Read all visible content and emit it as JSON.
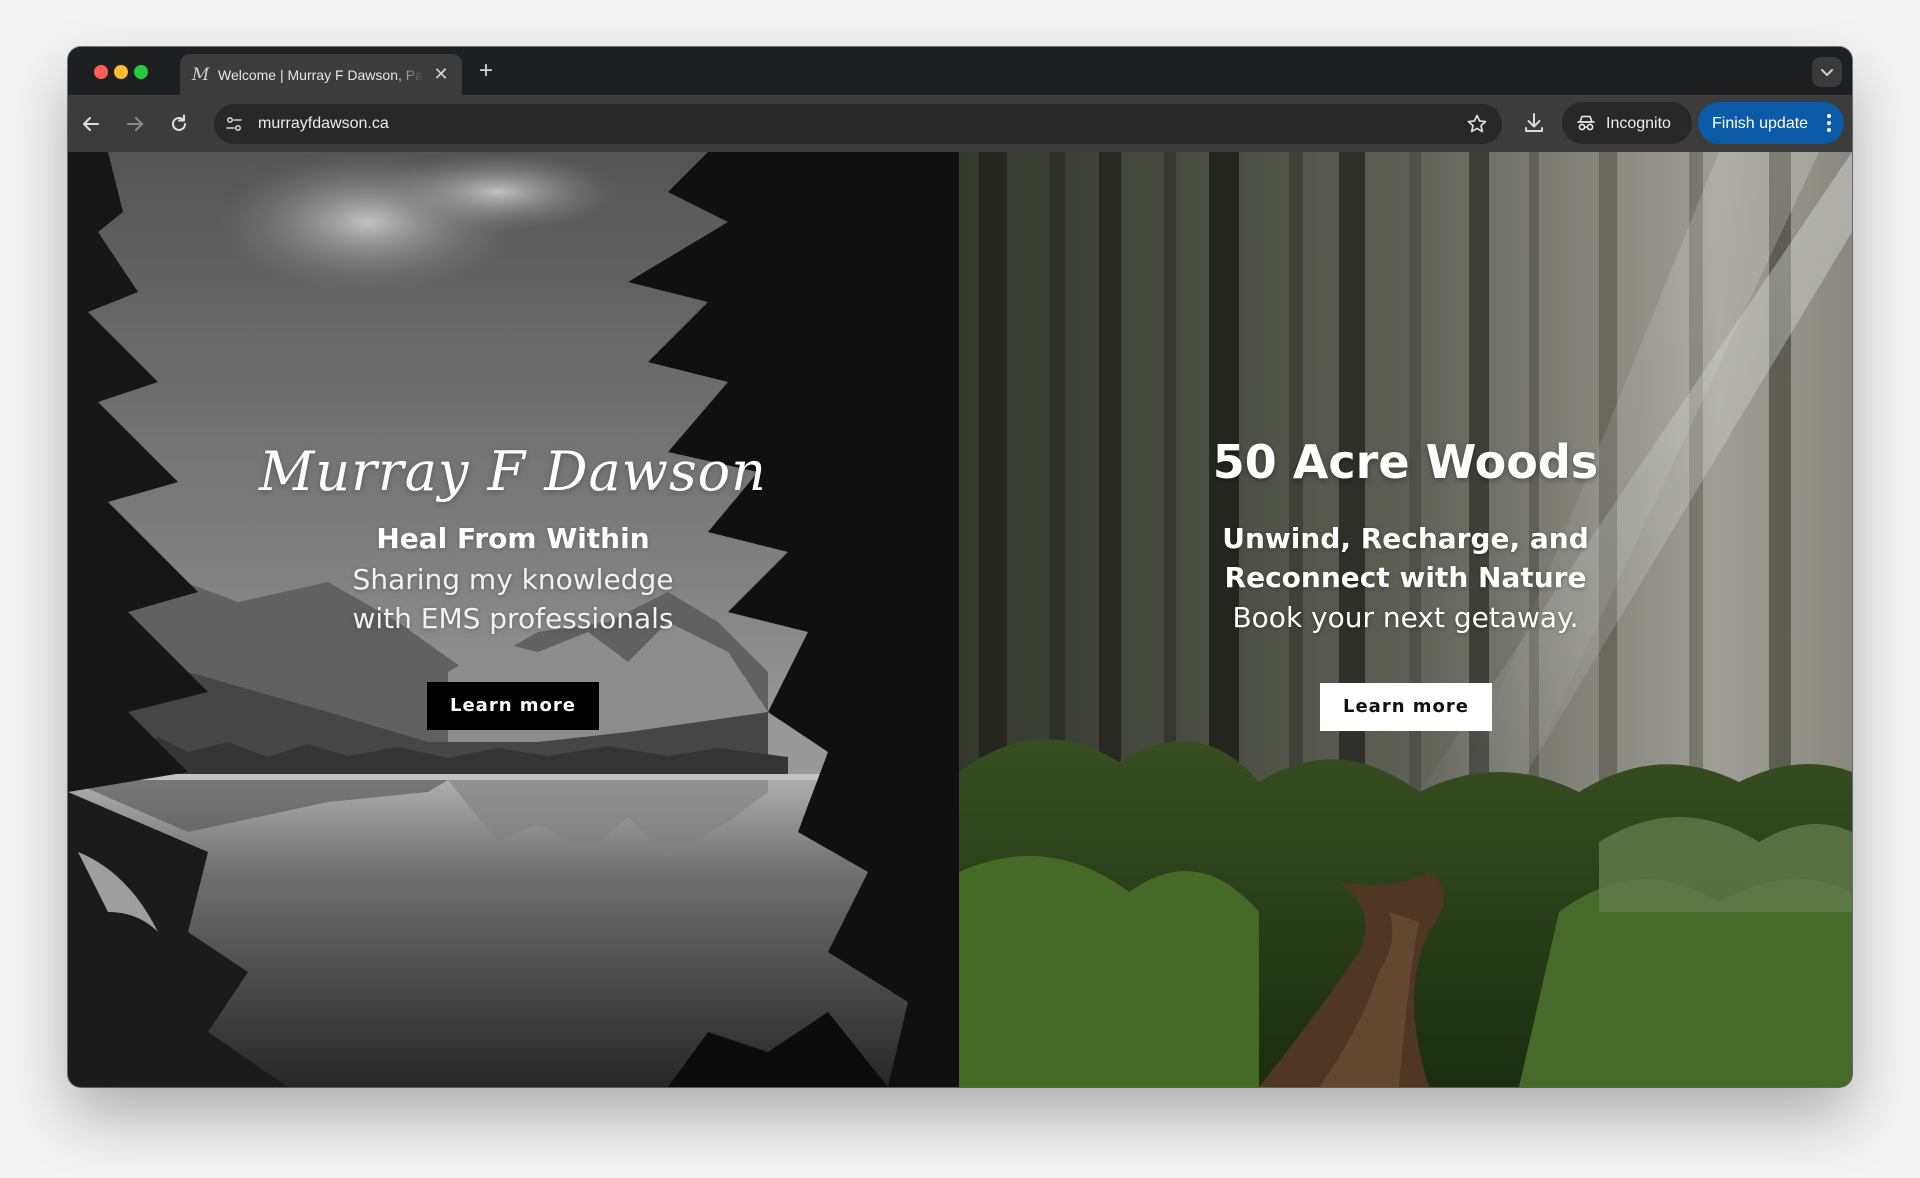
{
  "browser": {
    "tab": {
      "favicon_glyph": "M",
      "title": "Welcome | Murray F Dawson, Paramedic",
      "close_glyph": "✕"
    },
    "new_tab_glyph": "+",
    "address_bar": {
      "url": "murrayfdawson.ca"
    },
    "incognito_label": "Incognito",
    "update_button_label": "Finish update",
    "colors": {
      "update_button": "#0b5aa8",
      "toolbar": "#3c3c3c",
      "tabstrip": "#1e1f20"
    },
    "icons": [
      "back-arrow-icon",
      "forward-arrow-icon",
      "reload-icon",
      "site-info-icon",
      "bookmark-star-icon",
      "download-icon",
      "incognito-icon",
      "more-vert-icon",
      "tab-search-chevron-icon"
    ]
  },
  "page": {
    "left_panel": {
      "title": "Murray F Dawson",
      "tagline": "Heal From Within",
      "description_line1": "Sharing my knowledge",
      "description_line2": "with EMS professionals",
      "button_label": "Learn more",
      "button_color": "#000000"
    },
    "right_panel": {
      "title": "50 Acre Woods",
      "tagline_line1": "Unwind, Recharge, and",
      "tagline_line2": "Reconnect with Nature",
      "description": "Book your next getaway.",
      "button_label": "Learn more",
      "button_color": "#ffffff"
    }
  }
}
